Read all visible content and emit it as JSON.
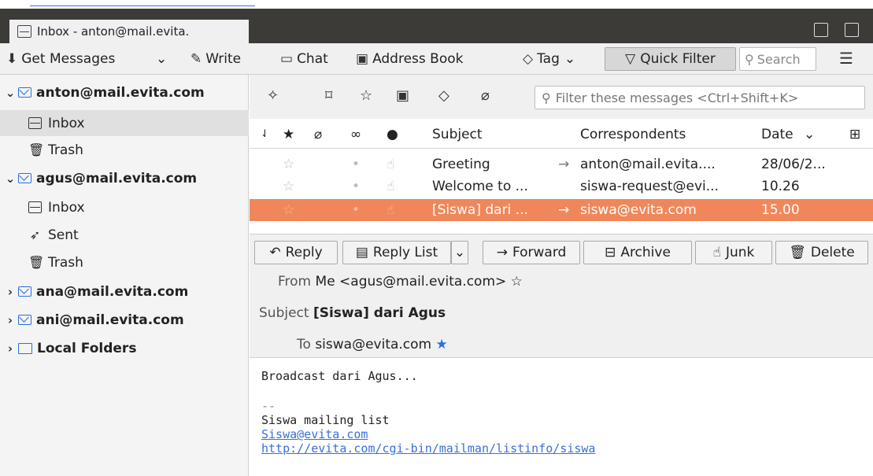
{
  "window": {
    "tab_title": "Inbox - anton@mail.evita."
  },
  "toolbar": {
    "get_messages": "Get Messages",
    "write": "Write",
    "chat": "Chat",
    "address_book": "Address Book",
    "tag": "Tag",
    "quick_filter": "Quick Filter",
    "search_placeholder": "Search"
  },
  "sidebar": {
    "items": [
      {
        "label": "anton@mail.evita.com",
        "type": "account",
        "expanded": true
      },
      {
        "label": "Inbox",
        "type": "inbox",
        "selected": true
      },
      {
        "label": "Trash",
        "type": "trash"
      },
      {
        "label": "agus@mail.evita.com",
        "type": "account",
        "expanded": true
      },
      {
        "label": "Inbox",
        "type": "inbox"
      },
      {
        "label": "Sent",
        "type": "sent"
      },
      {
        "label": "Trash",
        "type": "trash"
      },
      {
        "label": "ana@mail.evita.com",
        "type": "account",
        "expanded": false
      },
      {
        "label": "ani@mail.evita.com",
        "type": "account",
        "expanded": false
      },
      {
        "label": "Local Folders",
        "type": "local",
        "expanded": false
      }
    ]
  },
  "quickfilter": {
    "filter_placeholder": "Filter these messages <Ctrl+Shift+K>"
  },
  "message_list": {
    "headers": {
      "subject": "Subject",
      "correspondents": "Correspondents",
      "date": "Date"
    },
    "rows": [
      {
        "subject": "Greeting",
        "correspondent": "anton@mail.evita....",
        "date": "28/06/2...",
        "outgoing": true
      },
      {
        "subject": "Welcome to ...",
        "correspondent": "siswa-request@evi...",
        "date": "10.26",
        "outgoing": false
      },
      {
        "subject": "[Siswa] dari ...",
        "correspondent": "siswa@evita.com",
        "date": "15.00",
        "outgoing": true,
        "selected": true
      }
    ]
  },
  "message": {
    "actions": {
      "reply": "Reply",
      "reply_list": "Reply List",
      "forward": "Forward",
      "archive": "Archive",
      "junk": "Junk",
      "delete": "Delete"
    },
    "from_label": "From",
    "from": "Me <agus@mail.evita.com>",
    "subject_label": "Subject",
    "subject": "[Siswa] dari Agus",
    "to_label": "To",
    "to": "siswa@evita.com",
    "body": {
      "line1": "Broadcast dari Agus...",
      "sig_sep": "--",
      "sig_name": "Siswa mailing list",
      "link1": "Siswa@evita.com",
      "link2": "http://evita.com/cgi-bin/mailman/listinfo/siswa"
    }
  },
  "colors": {
    "selected_row": "#f0875a",
    "accent": "#2b6ee3",
    "titlebar": "#3c3b37"
  }
}
